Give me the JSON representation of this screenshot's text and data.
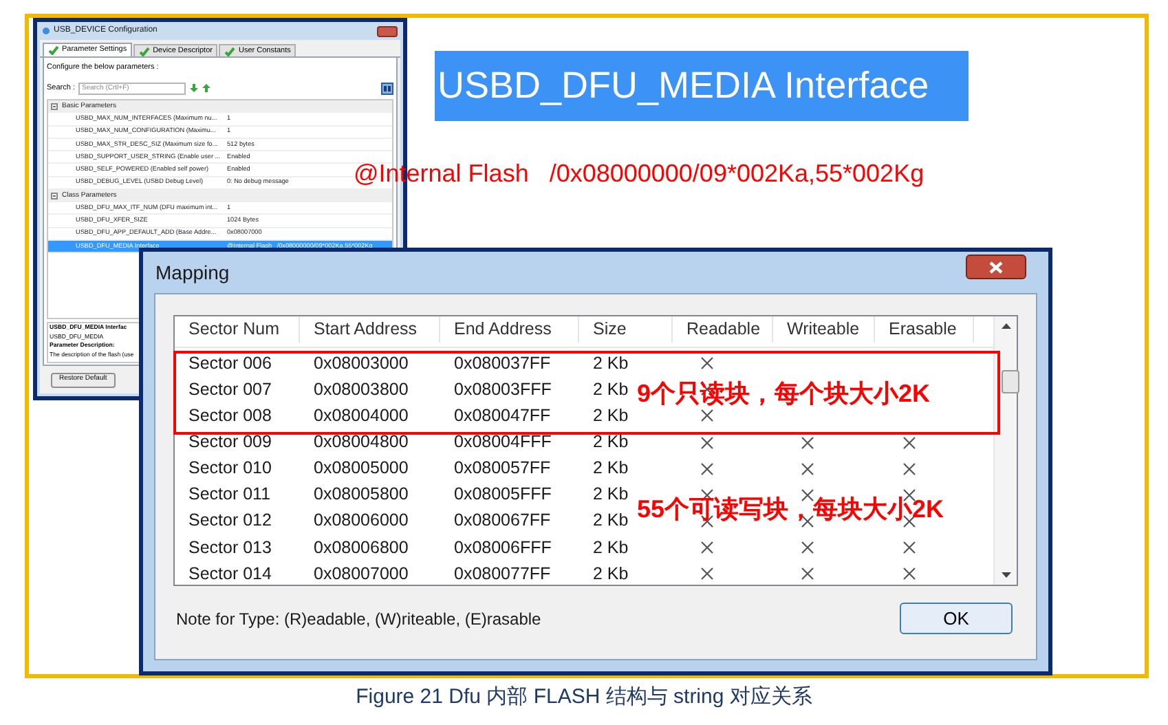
{
  "config_window": {
    "title": "USB_DEVICE Configuration",
    "tabs": [
      {
        "label": "Parameter Settings",
        "selected": true
      },
      {
        "label": "Device Descriptor",
        "selected": false
      },
      {
        "label": "User Constants",
        "selected": false
      }
    ],
    "instruction": "Configure the below parameters :",
    "search": {
      "label": "Search :",
      "placeholder": "Search (Crtl+F)"
    },
    "tree": [
      {
        "label": "Basic Parameters",
        "expanded": true,
        "children": [
          {
            "name": "USBD_MAX_NUM_INTERFACES (Maximum nu...",
            "value": "1",
            "selected": false
          },
          {
            "name": "USBD_MAX_NUM_CONFIGURATION (Maximu...",
            "value": "1",
            "selected": false
          },
          {
            "name": "USBD_MAX_STR_DESC_SIZ (Maximum size fo...",
            "value": "512 bytes",
            "selected": false
          },
          {
            "name": "USBD_SUPPORT_USER_STRING (Enable user ...",
            "value": "Enabled",
            "selected": false
          },
          {
            "name": "USBD_SELF_POWERED (Enabled self power)",
            "value": "Enabled",
            "selected": false
          },
          {
            "name": "USBD_DEBUG_LEVEL (USBD Debug Level)",
            "value": "0: No debug message",
            "selected": false
          }
        ]
      },
      {
        "label": "Class Parameters",
        "expanded": true,
        "children": [
          {
            "name": "USBD_DFU_MAX_ITF_NUM (DFU maximum int...",
            "value": "1",
            "selected": false
          },
          {
            "name": "USBD_DFU_XFER_SIZE",
            "value": "1024 Bytes",
            "selected": false
          },
          {
            "name": "USBD_DFU_APP_DEFAULT_ADD (Base Addre...",
            "value": "0x08007000",
            "selected": false
          },
          {
            "name": "USBD_DFU_MEDIA Interface",
            "value": "@Internal Flash   /0x08000000/09*002Ka,55*002Kg",
            "selected": true
          }
        ]
      }
    ],
    "description": {
      "heading": "USBD_DFU_MEDIA Interfac",
      "name": "USBD_DFU_MEDIA",
      "label": "Parameter Description:",
      "text": "The description of the flash (use"
    },
    "button": "Restore Default"
  },
  "interface_label": "USBD_DFU_MEDIA Interface",
  "flash_string": "@Internal Flash   /0x08000000/09*002Ka,55*002Kg",
  "mapping_dialog": {
    "title": "Mapping",
    "columns": [
      "Sector Num",
      "Start Address",
      "End Address",
      "Size",
      "Readable",
      "Writeable",
      "Erasable"
    ],
    "rows": [
      {
        "sector": "Sector 006",
        "start": "0x08003000",
        "end": "0x080037FF",
        "size": "2 Kb",
        "readable": true,
        "writeable": false,
        "erasable": false
      },
      {
        "sector": "Sector 007",
        "start": "0x08003800",
        "end": "0x08003FFF",
        "size": "2 Kb",
        "readable": true,
        "writeable": false,
        "erasable": false
      },
      {
        "sector": "Sector 008",
        "start": "0x08004000",
        "end": "0x080047FF",
        "size": "2 Kb",
        "readable": true,
        "writeable": false,
        "erasable": false
      },
      {
        "sector": "Sector 009",
        "start": "0x08004800",
        "end": "0x08004FFF",
        "size": "2 Kb",
        "readable": true,
        "writeable": true,
        "erasable": true
      },
      {
        "sector": "Sector 010",
        "start": "0x08005000",
        "end": "0x080057FF",
        "size": "2 Kb",
        "readable": true,
        "writeable": true,
        "erasable": true
      },
      {
        "sector": "Sector 011",
        "start": "0x08005800",
        "end": "0x08005FFF",
        "size": "2 Kb",
        "readable": true,
        "writeable": true,
        "erasable": true
      },
      {
        "sector": "Sector 012",
        "start": "0x08006000",
        "end": "0x080067FF",
        "size": "2 Kb",
        "readable": true,
        "writeable": true,
        "erasable": true
      },
      {
        "sector": "Sector 013",
        "start": "0x08006800",
        "end": "0x08006FFF",
        "size": "2 Kb",
        "readable": true,
        "writeable": true,
        "erasable": true
      },
      {
        "sector": "Sector 014",
        "start": "0x08007000",
        "end": "0x080077FF",
        "size": "2 Kb",
        "readable": true,
        "writeable": true,
        "erasable": true
      }
    ],
    "note": "Note for Type: (R)eadable, (W)riteable, (E)rasable",
    "ok_button": "OK"
  },
  "annotations": [
    "9个只读块，每个块大小2K",
    "55个可读写块，每块大小2K"
  ],
  "caption": "Figure 21 Dfu 内部 FLASH 结构与 string 对应关系"
}
